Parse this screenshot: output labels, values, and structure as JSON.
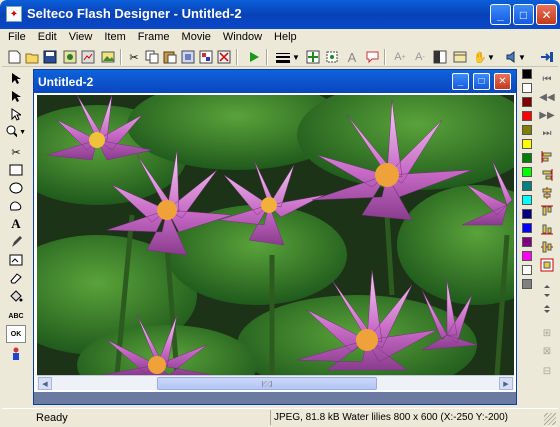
{
  "app": {
    "title": "Selteco Flash Designer - Untitled-2"
  },
  "menu": [
    "File",
    "Edit",
    "View",
    "Item",
    "Frame",
    "Movie",
    "Window",
    "Help"
  ],
  "document": {
    "title": "Untitled-2",
    "image_subject": "Water lilies"
  },
  "status": {
    "left": "Ready",
    "right": "JPEG, 81.8 kB Water lilies 800 x 600 (X:-250 Y:-200)"
  },
  "toolbar_icons": [
    "new-icon",
    "open-icon",
    "save-icon",
    "import-icon",
    "export-icon",
    "cut-icon",
    "copy-icon",
    "paste-icon",
    "delete-icon",
    "play-icon",
    "line-width-icon",
    "snap-icon",
    "text-icon",
    "callout-icon",
    "font-bigger-icon",
    "font-smaller-icon",
    "fill-icon",
    "hand-icon",
    "sound-icon",
    "exit-icon"
  ],
  "left_tools": [
    "arrow-select-icon",
    "direct-select-icon",
    "point-select-icon",
    "zoom-icon",
    "cut-tool-icon",
    "rectangle-icon",
    "ellipse-icon",
    "polygon-icon",
    "text-tool-icon",
    "pen-icon",
    "image-tool-icon",
    "eraser-icon",
    "bucket-icon",
    "abc-icon",
    "ok-button-icon",
    "sprite-icon"
  ],
  "palette_colors": [
    "#000000",
    "#ffffff",
    "#800000",
    "#ff0000",
    "#808000",
    "#ffff00",
    "#008000",
    "#00ff00",
    "#008080",
    "#00ffff",
    "#000080",
    "#0000ff",
    "#800080",
    "#ff00ff",
    "#ffffff",
    "#808080"
  ]
}
